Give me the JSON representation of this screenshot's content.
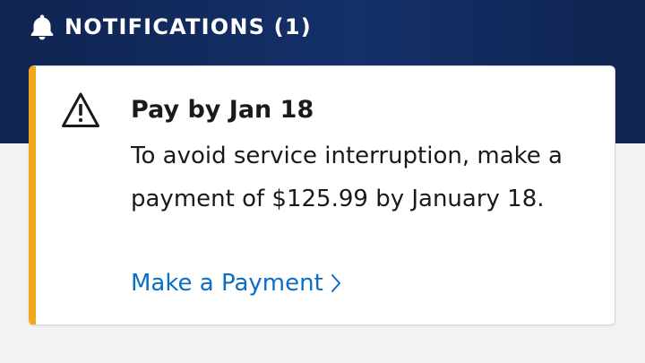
{
  "header": {
    "icon": "bell-icon",
    "title": "NOTIFICATIONS (1)"
  },
  "notification": {
    "icon": "warning-triangle-icon",
    "accent_color": "#f0a81e",
    "title": "Pay by Jan 18",
    "message": "To avoid service interruption, make a payment of $125.99 by January 18.",
    "link_label": "Make a Payment",
    "link_icon": "chevron-right-icon"
  },
  "colors": {
    "header_background": "#15306a",
    "link": "#0a6ec6"
  }
}
